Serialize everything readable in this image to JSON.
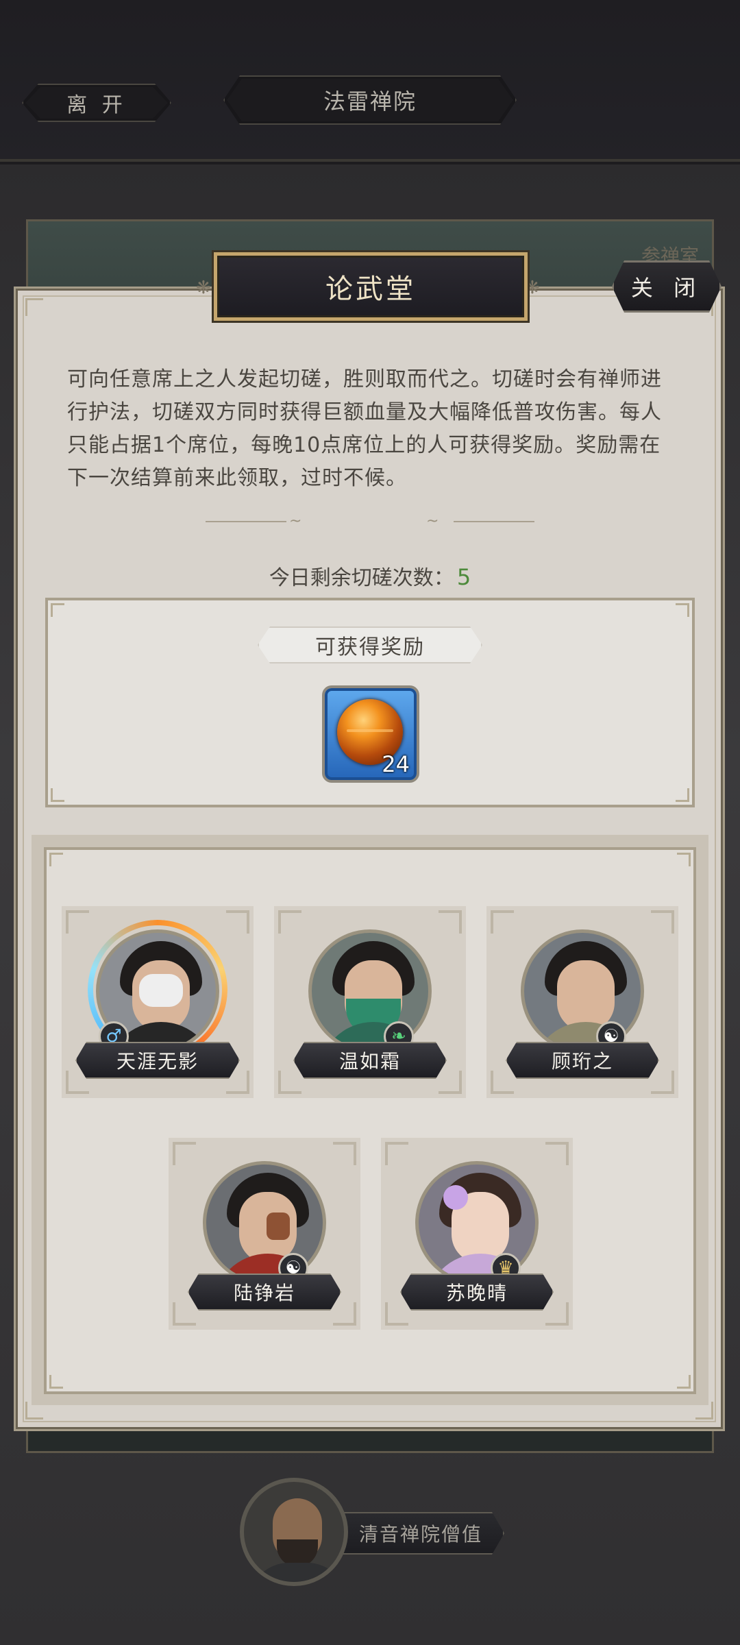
{
  "topbar": {
    "leave_label": "离 开",
    "location_title": "法雷禅院"
  },
  "background": {
    "room_label": "参禅室"
  },
  "panel": {
    "title": "论武堂",
    "close_label": "关 闭",
    "description": "可向任意席上之人发起切磋，胜则取而代之。切磋时会有禅师进行护法，切磋双方同时获得巨额血量及大幅降低普攻伤害。每人只能占据1个席位，每晚10点席位上的人可获得奖励。奖励需在下一次结算前来此领取，过时不候。",
    "remaining_label": "今日剩余切磋次数：",
    "remaining_count": "5"
  },
  "reward": {
    "label": "可获得奖励",
    "item_icon": "amber-orb-icon",
    "item_count": "24"
  },
  "seats": [
    {
      "name": "天涯无影",
      "badge": "male-icon"
    },
    {
      "name": "温如霜",
      "badge": "sect-green-icon"
    },
    {
      "name": "顾珩之",
      "badge": "taiji-icon"
    },
    {
      "name": "陆铮岩",
      "badge": "taiji-icon"
    },
    {
      "name": "苏晚晴",
      "badge": "gold-sect-icon"
    }
  ],
  "npc": {
    "label": "清音禅院僧值"
  },
  "colors": {
    "accent_gold": "#c5a66d",
    "count_green": "#4d8a3b",
    "panel_bg": "#d8d3cc",
    "reward_blue": "#2565b8"
  }
}
